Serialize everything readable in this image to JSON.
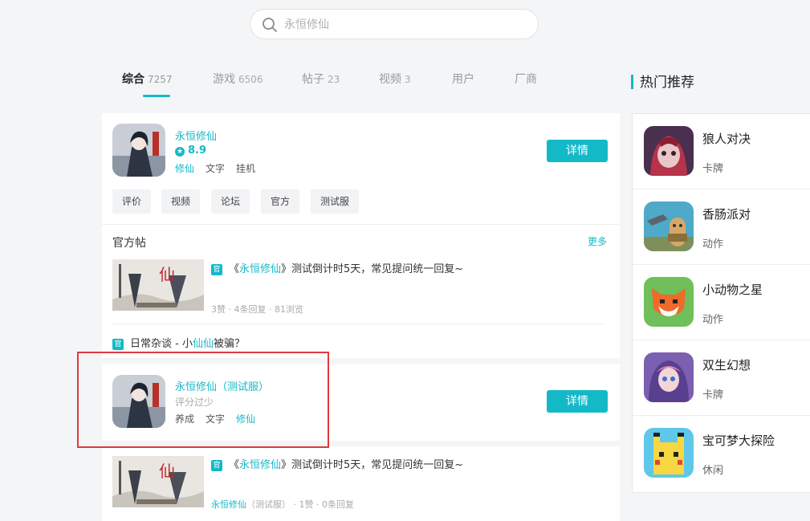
{
  "search": {
    "placeholder": "永恒修仙"
  },
  "tabs": [
    {
      "label": "综合",
      "count": "7257"
    },
    {
      "label": "游戏",
      "count": "6506"
    },
    {
      "label": "帖子",
      "count": "23"
    },
    {
      "label": "视频",
      "count": "3"
    },
    {
      "label": "用户",
      "count": ""
    },
    {
      "label": "厂商",
      "count": ""
    }
  ],
  "game1": {
    "name": "永恒修仙",
    "rating": "8.9",
    "tags": [
      "修仙",
      "文字",
      "挂机"
    ],
    "detail_label": "详情",
    "chips": [
      "评价",
      "视频",
      "论坛",
      "官方",
      "测试服"
    ]
  },
  "official": {
    "title": "官方帖",
    "more": "更多",
    "badge": "官",
    "post1": {
      "title_pre": "《",
      "title_link": "永恒修仙",
      "title_post": "》测试倒计时5天，常见提问统一回复~",
      "meta": "3赞 · 4条回复 · 81浏览"
    },
    "post2": {
      "pre": "日常杂谈 - 小",
      "link": "仙仙",
      "post": "被骗？"
    }
  },
  "game2": {
    "name": "永恒修仙（测试服）",
    "rating_text": "评分过少",
    "tags": [
      "养成",
      "文字",
      "修仙"
    ],
    "detail_label": "详情",
    "post": {
      "title_pre": "《",
      "title_link": "永恒修仙",
      "title_post": "》测试倒计时5天，常见提问统一回复~",
      "meta_link": "永恒修仙",
      "meta_rest": "（测试服） · 1赞 · 0条回复"
    }
  },
  "sidebar": {
    "title": "热门推荐",
    "items": [
      {
        "name": "狼人对决",
        "category": "卡牌",
        "icon": "werewolf-game-icon"
      },
      {
        "name": "香肠派对",
        "category": "动作",
        "icon": "sausage-party-icon"
      },
      {
        "name": "小动物之星",
        "category": "动作",
        "icon": "fox-game-icon"
      },
      {
        "name": "双生幻想",
        "category": "卡牌",
        "icon": "anime-girl-game-icon"
      },
      {
        "name": "宝可梦大探险",
        "category": "休闲",
        "icon": "pikachu-cube-icon"
      }
    ]
  },
  "colors": {
    "accent": "#14b9c8",
    "highlight": "#e0393b"
  }
}
